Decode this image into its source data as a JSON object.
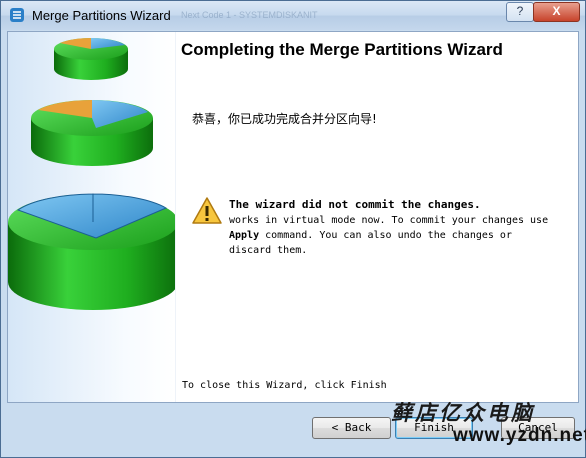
{
  "window": {
    "title": "Merge Partitions Wizard",
    "ghost_title": "Next Code 1 - SYSTEMDISKANIT",
    "help_button": "?",
    "close_button": "X"
  },
  "main": {
    "heading": "Completing the Merge Partitions Wizard",
    "congrats": "恭喜，你已成功完成合并分区向导!",
    "warning": {
      "icon": "warning-icon",
      "title": "The wizard did not commit the changes.",
      "line1": "works in virtual mode now. To commit your changes use",
      "apply_word": "Apply",
      "line2_rest": " command. You can also undo the changes or",
      "line3": "discard them."
    },
    "close_hint": "To close this Wizard, click Finish"
  },
  "buttons": {
    "back": "< Back",
    "finish": "Finish",
    "cancel": "Cancel"
  },
  "watermark": {
    "chinese": "藓店亿众电脑",
    "url": "www.yzdn.net"
  },
  "colors": {
    "green": "#1fae1f",
    "blue_top": "#4aa3df",
    "orange": "#e8a23a",
    "accent": "#3c7fb1"
  }
}
